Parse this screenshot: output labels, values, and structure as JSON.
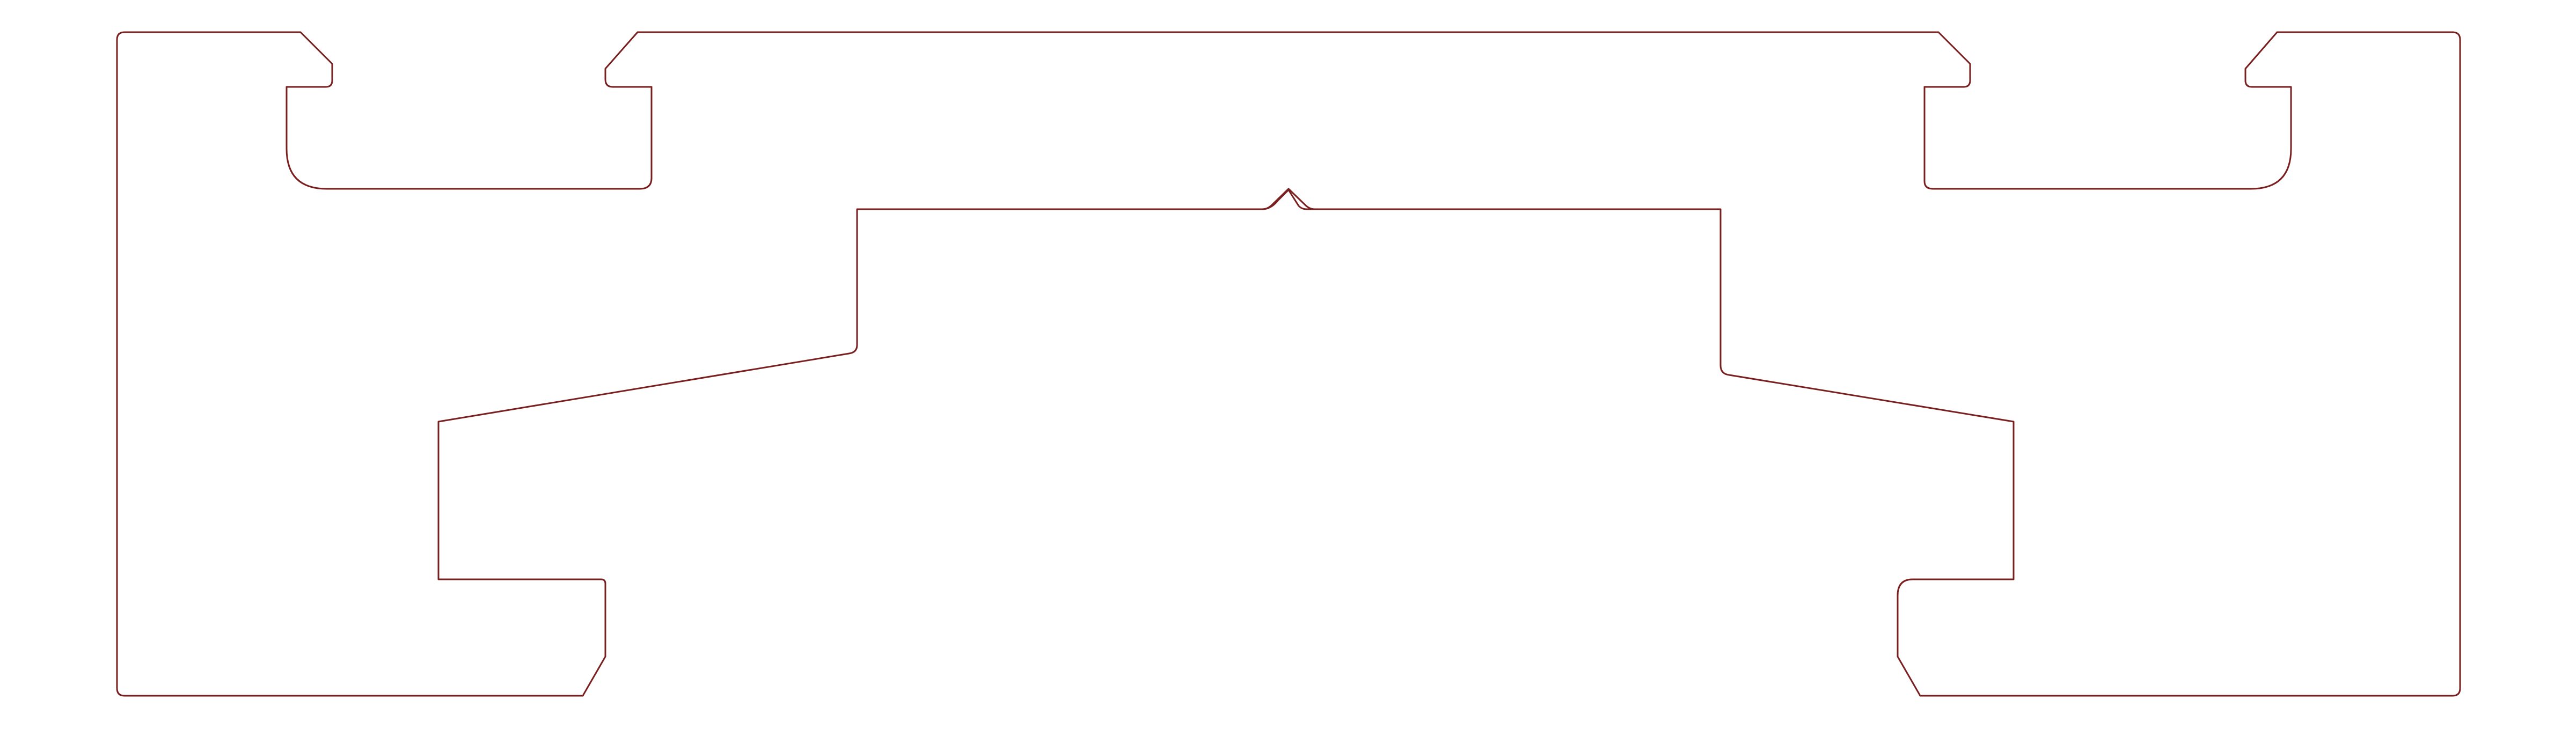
{
  "drawing": {
    "background_color": "#ffffff",
    "stroke_color": "#7a1f1f",
    "features": [
      {
        "name": "outer-profile-outline"
      },
      {
        "name": "center-v-notch"
      },
      {
        "name": "upper-left-t-slot"
      },
      {
        "name": "upper-right-t-slot"
      },
      {
        "name": "lower-left-foot-recess"
      },
      {
        "name": "lower-right-foot-recess"
      },
      {
        "name": "left-sloped-shoulder"
      },
      {
        "name": "right-sloped-shoulder"
      }
    ]
  }
}
